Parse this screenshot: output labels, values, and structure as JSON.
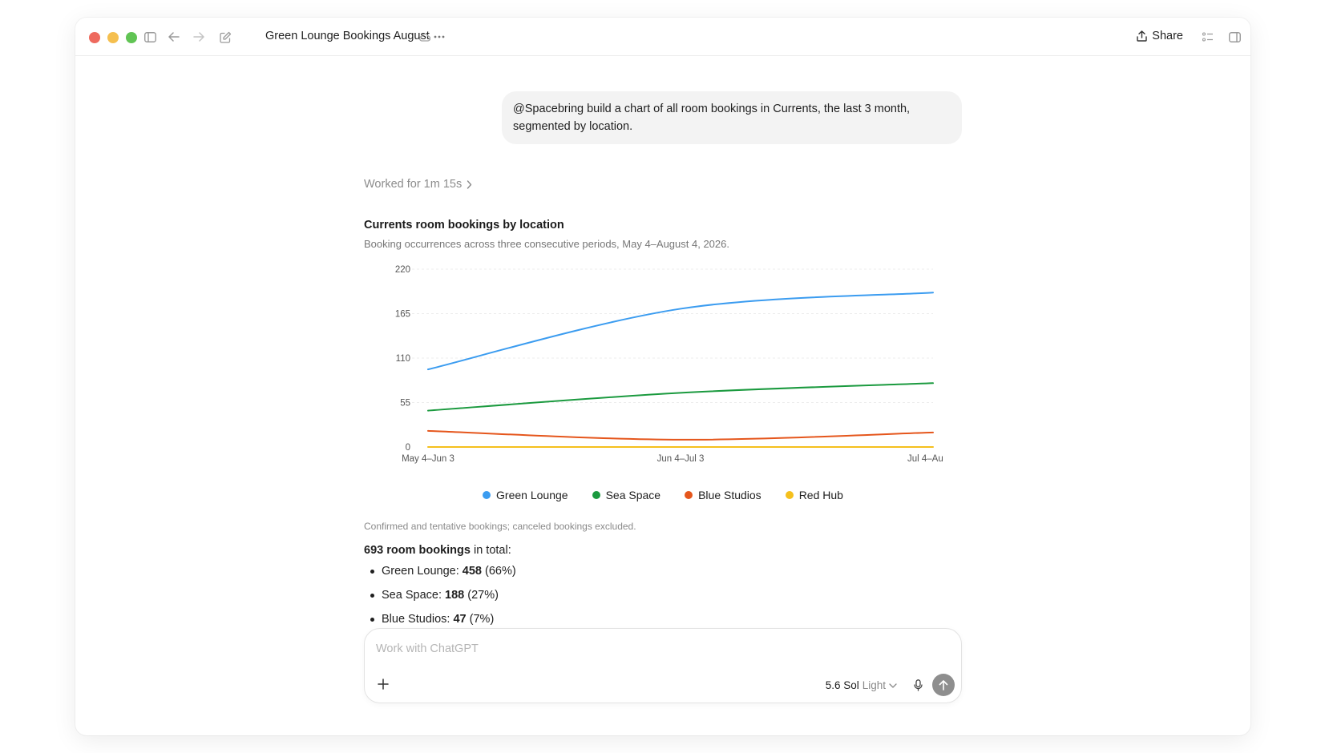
{
  "window": {
    "title": "Green Lounge Bookings August",
    "share_label": "Share"
  },
  "conversation": {
    "user_message": "@Spacebring build a chart of all room bookings in Currents, the last 3 month, segmented by location.",
    "worked_label": "Worked for 1m 15s"
  },
  "chart_data": {
    "type": "line",
    "title": "Currents room bookings by location",
    "subtitle": "Booking occurrences across three consecutive periods, May 4–August 4, 2026.",
    "categories": [
      "May 4–Jun 3",
      "Jun 4–Jul 3",
      "Jul 4–Au"
    ],
    "yticks": [
      0,
      55,
      110,
      165,
      220
    ],
    "ylim": [
      0,
      220
    ],
    "grid": true,
    "legend": "bottom",
    "series": [
      {
        "name": "Green Lounge",
        "color": "#3b9cf0",
        "values": [
          96,
          171,
          191
        ]
      },
      {
        "name": "Sea Space",
        "color": "#1b9a3f",
        "values": [
          45,
          67,
          79
        ]
      },
      {
        "name": "Blue Studios",
        "color": "#e5561c",
        "values": [
          20,
          9,
          18
        ]
      },
      {
        "name": "Red Hub",
        "color": "#f5c01d",
        "values": [
          0,
          0,
          0
        ]
      }
    ]
  },
  "summary": {
    "note": "Confirmed and tentative bookings; canceled bookings excluded.",
    "total_bold": "693 room bookings",
    "total_rest": " in total:",
    "items": [
      {
        "name": "Green Lounge:",
        "count": "458",
        "pct": "(66%)"
      },
      {
        "name": "Sea Space:",
        "count": "188",
        "pct": "(27%)"
      },
      {
        "name": "Blue Studios:",
        "count": "47",
        "pct": "(7%)"
      }
    ]
  },
  "composer": {
    "placeholder": "Work with ChatGPT",
    "model": "5.6 Sol",
    "effort": "Light"
  }
}
